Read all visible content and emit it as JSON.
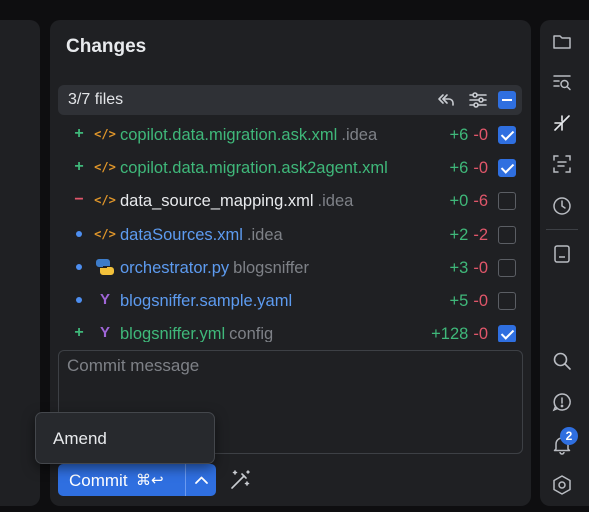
{
  "panel": {
    "title": "Changes"
  },
  "files_header": {
    "count_label": "3/7 files"
  },
  "files": [
    {
      "status": "added",
      "status_symbol": "+",
      "icon": "xml-file-icon",
      "name": "copilot.data.migration.ask.xml",
      "path": ".idea",
      "additions": "+6",
      "deletions": "-0",
      "checked": true,
      "name_style": "add"
    },
    {
      "status": "added",
      "status_symbol": "+",
      "icon": "xml-file-icon",
      "name": "copilot.data.migration.ask2agent.xml",
      "path": "",
      "additions": "+6",
      "deletions": "-0",
      "checked": true,
      "name_style": "add"
    },
    {
      "status": "deleted",
      "status_symbol": "−",
      "icon": "xml-file-icon",
      "name": "data_source_mapping.xml",
      "path": ".idea",
      "additions": "+0",
      "deletions": "-6",
      "checked": false,
      "name_style": "plain"
    },
    {
      "status": "modified",
      "status_symbol": "",
      "icon": "xml-file-icon",
      "name": "dataSources.xml",
      "path": ".idea",
      "additions": "+2",
      "deletions": "-2",
      "checked": false,
      "name_style": "mod"
    },
    {
      "status": "modified",
      "status_symbol": "",
      "icon": "python-file-icon",
      "name": "orchestrator.py",
      "path": "blogsniffer",
      "additions": "+3",
      "deletions": "-0",
      "checked": false,
      "name_style": "mod"
    },
    {
      "status": "modified",
      "status_symbol": "",
      "icon": "yaml-file-icon",
      "name": "blogsniffer.sample.yaml",
      "path": "",
      "additions": "+5",
      "deletions": "-0",
      "checked": false,
      "name_style": "mod"
    },
    {
      "status": "added",
      "status_symbol": "+",
      "icon": "yaml-file-icon",
      "name": "blogsniffer.yml",
      "path": "config",
      "additions": "+128",
      "deletions": "-0",
      "checked": true,
      "name_style": "add"
    }
  ],
  "commit": {
    "message_placeholder": "Commit message",
    "button_label": "Commit",
    "shortcut": "⌘↩"
  },
  "popup_menu": {
    "items": [
      {
        "label": "Amend"
      }
    ]
  },
  "notifications": {
    "count": "2"
  },
  "colors": {
    "accent": "#2f6fe0",
    "added": "#3fb87a",
    "deleted": "#e0566a",
    "modified": "#5d9bf0"
  }
}
